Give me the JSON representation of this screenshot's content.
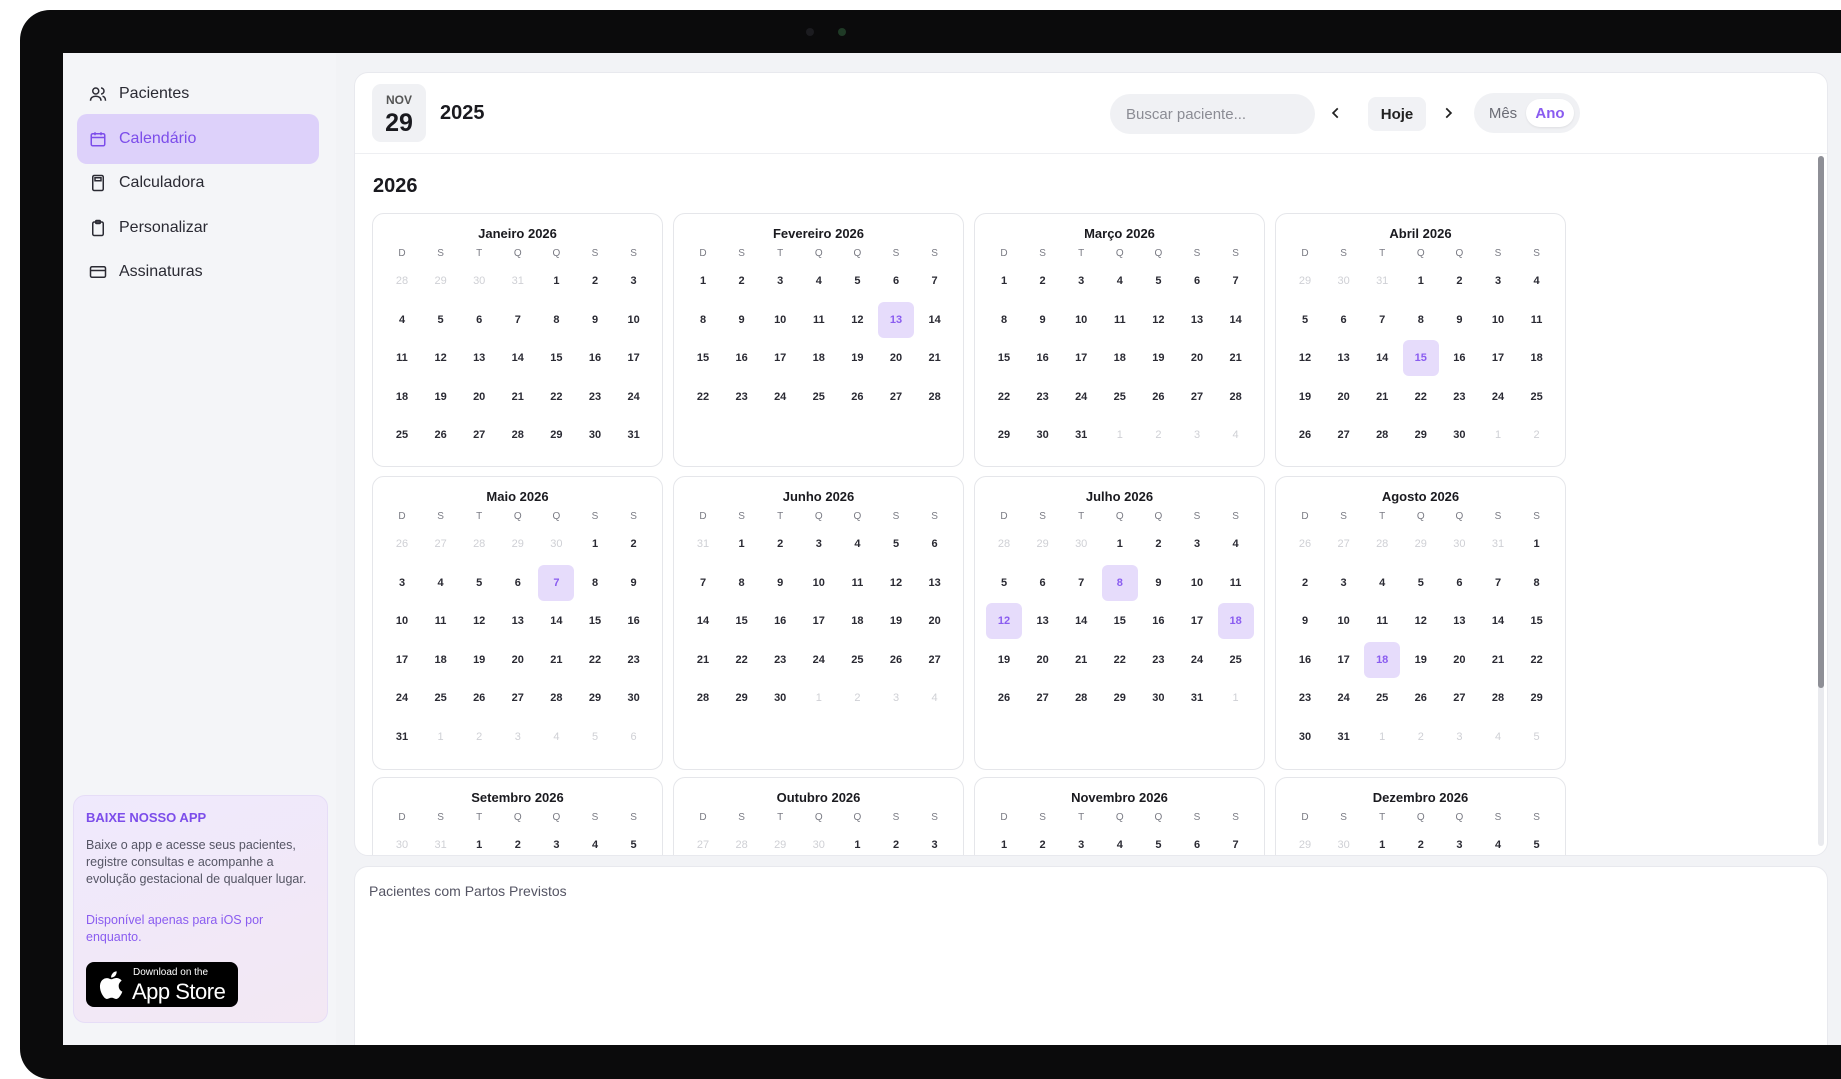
{
  "sidebar": {
    "items": [
      {
        "label": "Pacientes",
        "icon": "users-icon",
        "active": false
      },
      {
        "label": "Calendário",
        "icon": "calendar-icon",
        "active": true
      },
      {
        "label": "Calculadora",
        "icon": "calculator-icon",
        "active": false
      },
      {
        "label": "Personalizar",
        "icon": "clipboard-icon",
        "active": false
      },
      {
        "label": "Assinaturas",
        "icon": "card-icon",
        "active": false
      }
    ],
    "promo": {
      "title": "BAIXE NOSSO APP",
      "text": "Baixe o app e acesse seus pacientes, registre consultas e acompanhe a evolução gestacional de qualquer lugar.",
      "note": "Disponível apenas para iOS por enquanto.",
      "store_small": "Download on the",
      "store_big": "App Store"
    }
  },
  "header": {
    "month_abbr": "NOV",
    "day": "29",
    "year": "2025",
    "search_placeholder": "Buscar paciente...",
    "today_label": "Hoje",
    "view_month": "Mês",
    "view_year": "Ano"
  },
  "calendar": {
    "year_title": "2026",
    "weekdays": [
      "D",
      "S",
      "T",
      "Q",
      "Q",
      "S",
      "S"
    ],
    "months": [
      {
        "title": "Janeiro 2026",
        "lead": 4,
        "days": 31,
        "highlight": []
      },
      {
        "title": "Fevereiro 2026",
        "lead": 0,
        "days": 28,
        "highlight": [
          13
        ]
      },
      {
        "title": "Março 2026",
        "lead": 0,
        "days": 31,
        "highlight": []
      },
      {
        "title": "Abril 2026",
        "lead": 3,
        "days": 30,
        "highlight": [
          15
        ]
      },
      {
        "title": "Maio 2026",
        "lead": 5,
        "days": 31,
        "highlight": [
          7
        ]
      },
      {
        "title": "Junho 2026",
        "lead": 1,
        "days": 30,
        "highlight": []
      },
      {
        "title": "Julho 2026",
        "lead": 3,
        "days": 31,
        "highlight": [
          8,
          12,
          18
        ]
      },
      {
        "title": "Agosto 2026",
        "lead": 6,
        "days": 31,
        "highlight": [
          18
        ]
      },
      {
        "title": "Setembro 2026",
        "lead": 2,
        "days": 30,
        "highlight": []
      },
      {
        "title": "Outubro 2026",
        "lead": 4,
        "days": 31,
        "highlight": []
      },
      {
        "title": "Novembro 2026",
        "lead": 0,
        "days": 30,
        "highlight": []
      },
      {
        "title": "Dezembro 2026",
        "lead": 2,
        "days": 31,
        "highlight": []
      }
    ]
  },
  "bottom": {
    "title": "Pacientes com Partos Previstos"
  }
}
